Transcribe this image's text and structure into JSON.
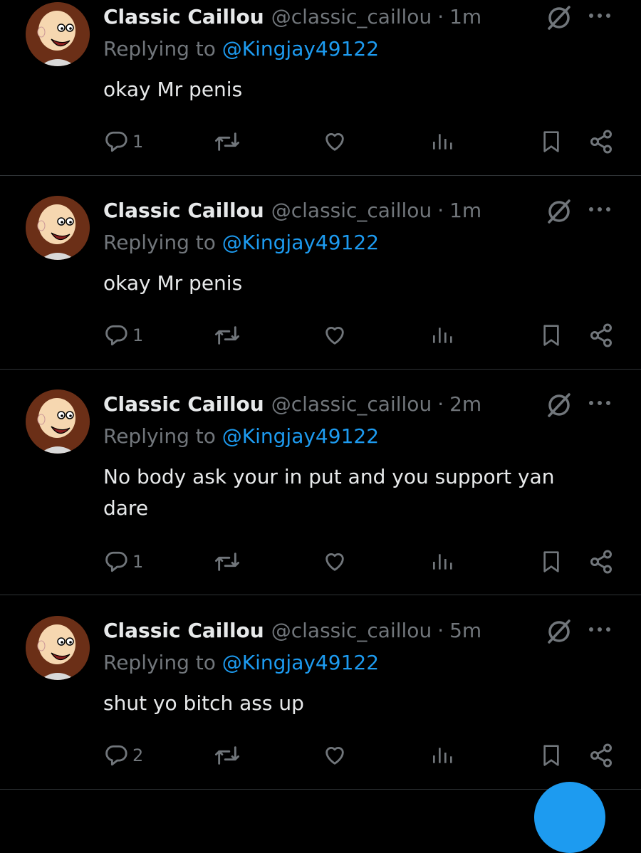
{
  "tweets": [
    {
      "name": "Classic Caillou",
      "handle": "@classic_caillou",
      "sep": "·",
      "time": "1m",
      "reply_prefix": "Replying to",
      "reply_to": "@Kingjay49122",
      "text": "okay Mr penis",
      "reply_count": "1"
    },
    {
      "name": "Classic Caillou",
      "handle": "@classic_caillou",
      "sep": "·",
      "time": "1m",
      "reply_prefix": "Replying to",
      "reply_to": "@Kingjay49122",
      "text": "okay Mr penis",
      "reply_count": "1"
    },
    {
      "name": "Classic Caillou",
      "handle": "@classic_caillou",
      "sep": "·",
      "time": "2m",
      "reply_prefix": "Replying to",
      "reply_to": "@Kingjay49122",
      "text": "No body ask your in put and you support yan dare",
      "reply_count": "1"
    },
    {
      "name": "Classic Caillou",
      "handle": "@classic_caillou",
      "sep": "·",
      "time": "5m",
      "reply_prefix": "Replying to",
      "reply_to": "@Kingjay49122",
      "text": "shut yo bitch ass up",
      "reply_count": "2"
    }
  ],
  "icons": {
    "avatar": "caillou-avatar-icon",
    "grok": "grok-icon",
    "more": "more-icon",
    "reply": "reply-icon",
    "retweet": "retweet-icon",
    "like": "heart-icon",
    "views": "views-icon",
    "bookmark": "bookmark-icon",
    "share": "share-icon"
  },
  "colors": {
    "background": "#000000",
    "text": "#e7e9ea",
    "muted": "#71767b",
    "accent": "#1d9bf0",
    "divider": "#2f3336"
  }
}
